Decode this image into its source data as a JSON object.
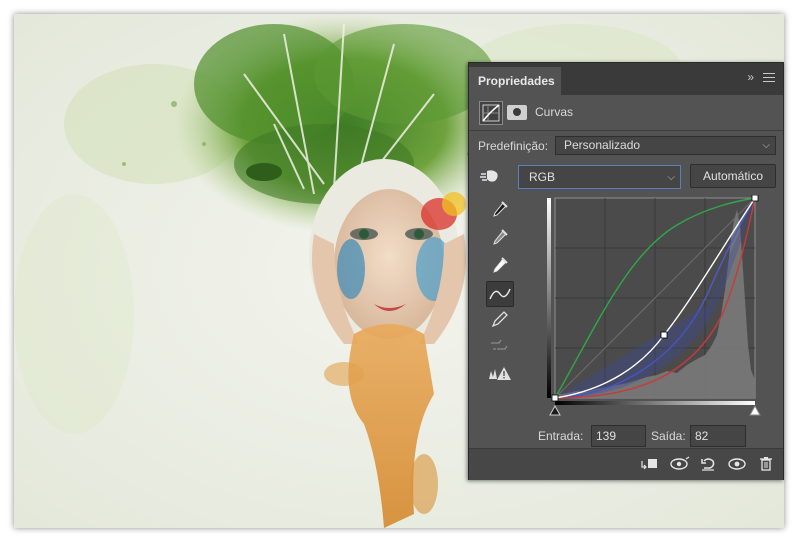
{
  "panel": {
    "tab_title": "Propriedades",
    "collapse_glyph": "»",
    "adjustment_label": "Curvas",
    "preset_label": "Predefinição:",
    "preset_value": "Personalizado",
    "channel_value": "RGB",
    "auto_button": "Automático",
    "input_label": "Entrada:",
    "input_value": "139",
    "output_label": "Saída:",
    "output_value": "82"
  },
  "tools": [
    "eyedropper-black-icon",
    "eyedropper-gray-icon",
    "eyedropper-white-icon",
    "curve-point-icon",
    "pencil-icon",
    "smooth-icon",
    "clipping-warning-icon"
  ],
  "bottom_buttons": [
    "clip-to-layer-icon",
    "view-previous-icon",
    "reset-icon",
    "visibility-eye-icon",
    "trash-icon"
  ],
  "colors": {
    "panel_bg": "#535353",
    "curve_rgb": "#ffffff",
    "curve_green": "#2fa84a",
    "curve_blue": "#4a5ad8",
    "curve_red": "#c83a3a"
  }
}
